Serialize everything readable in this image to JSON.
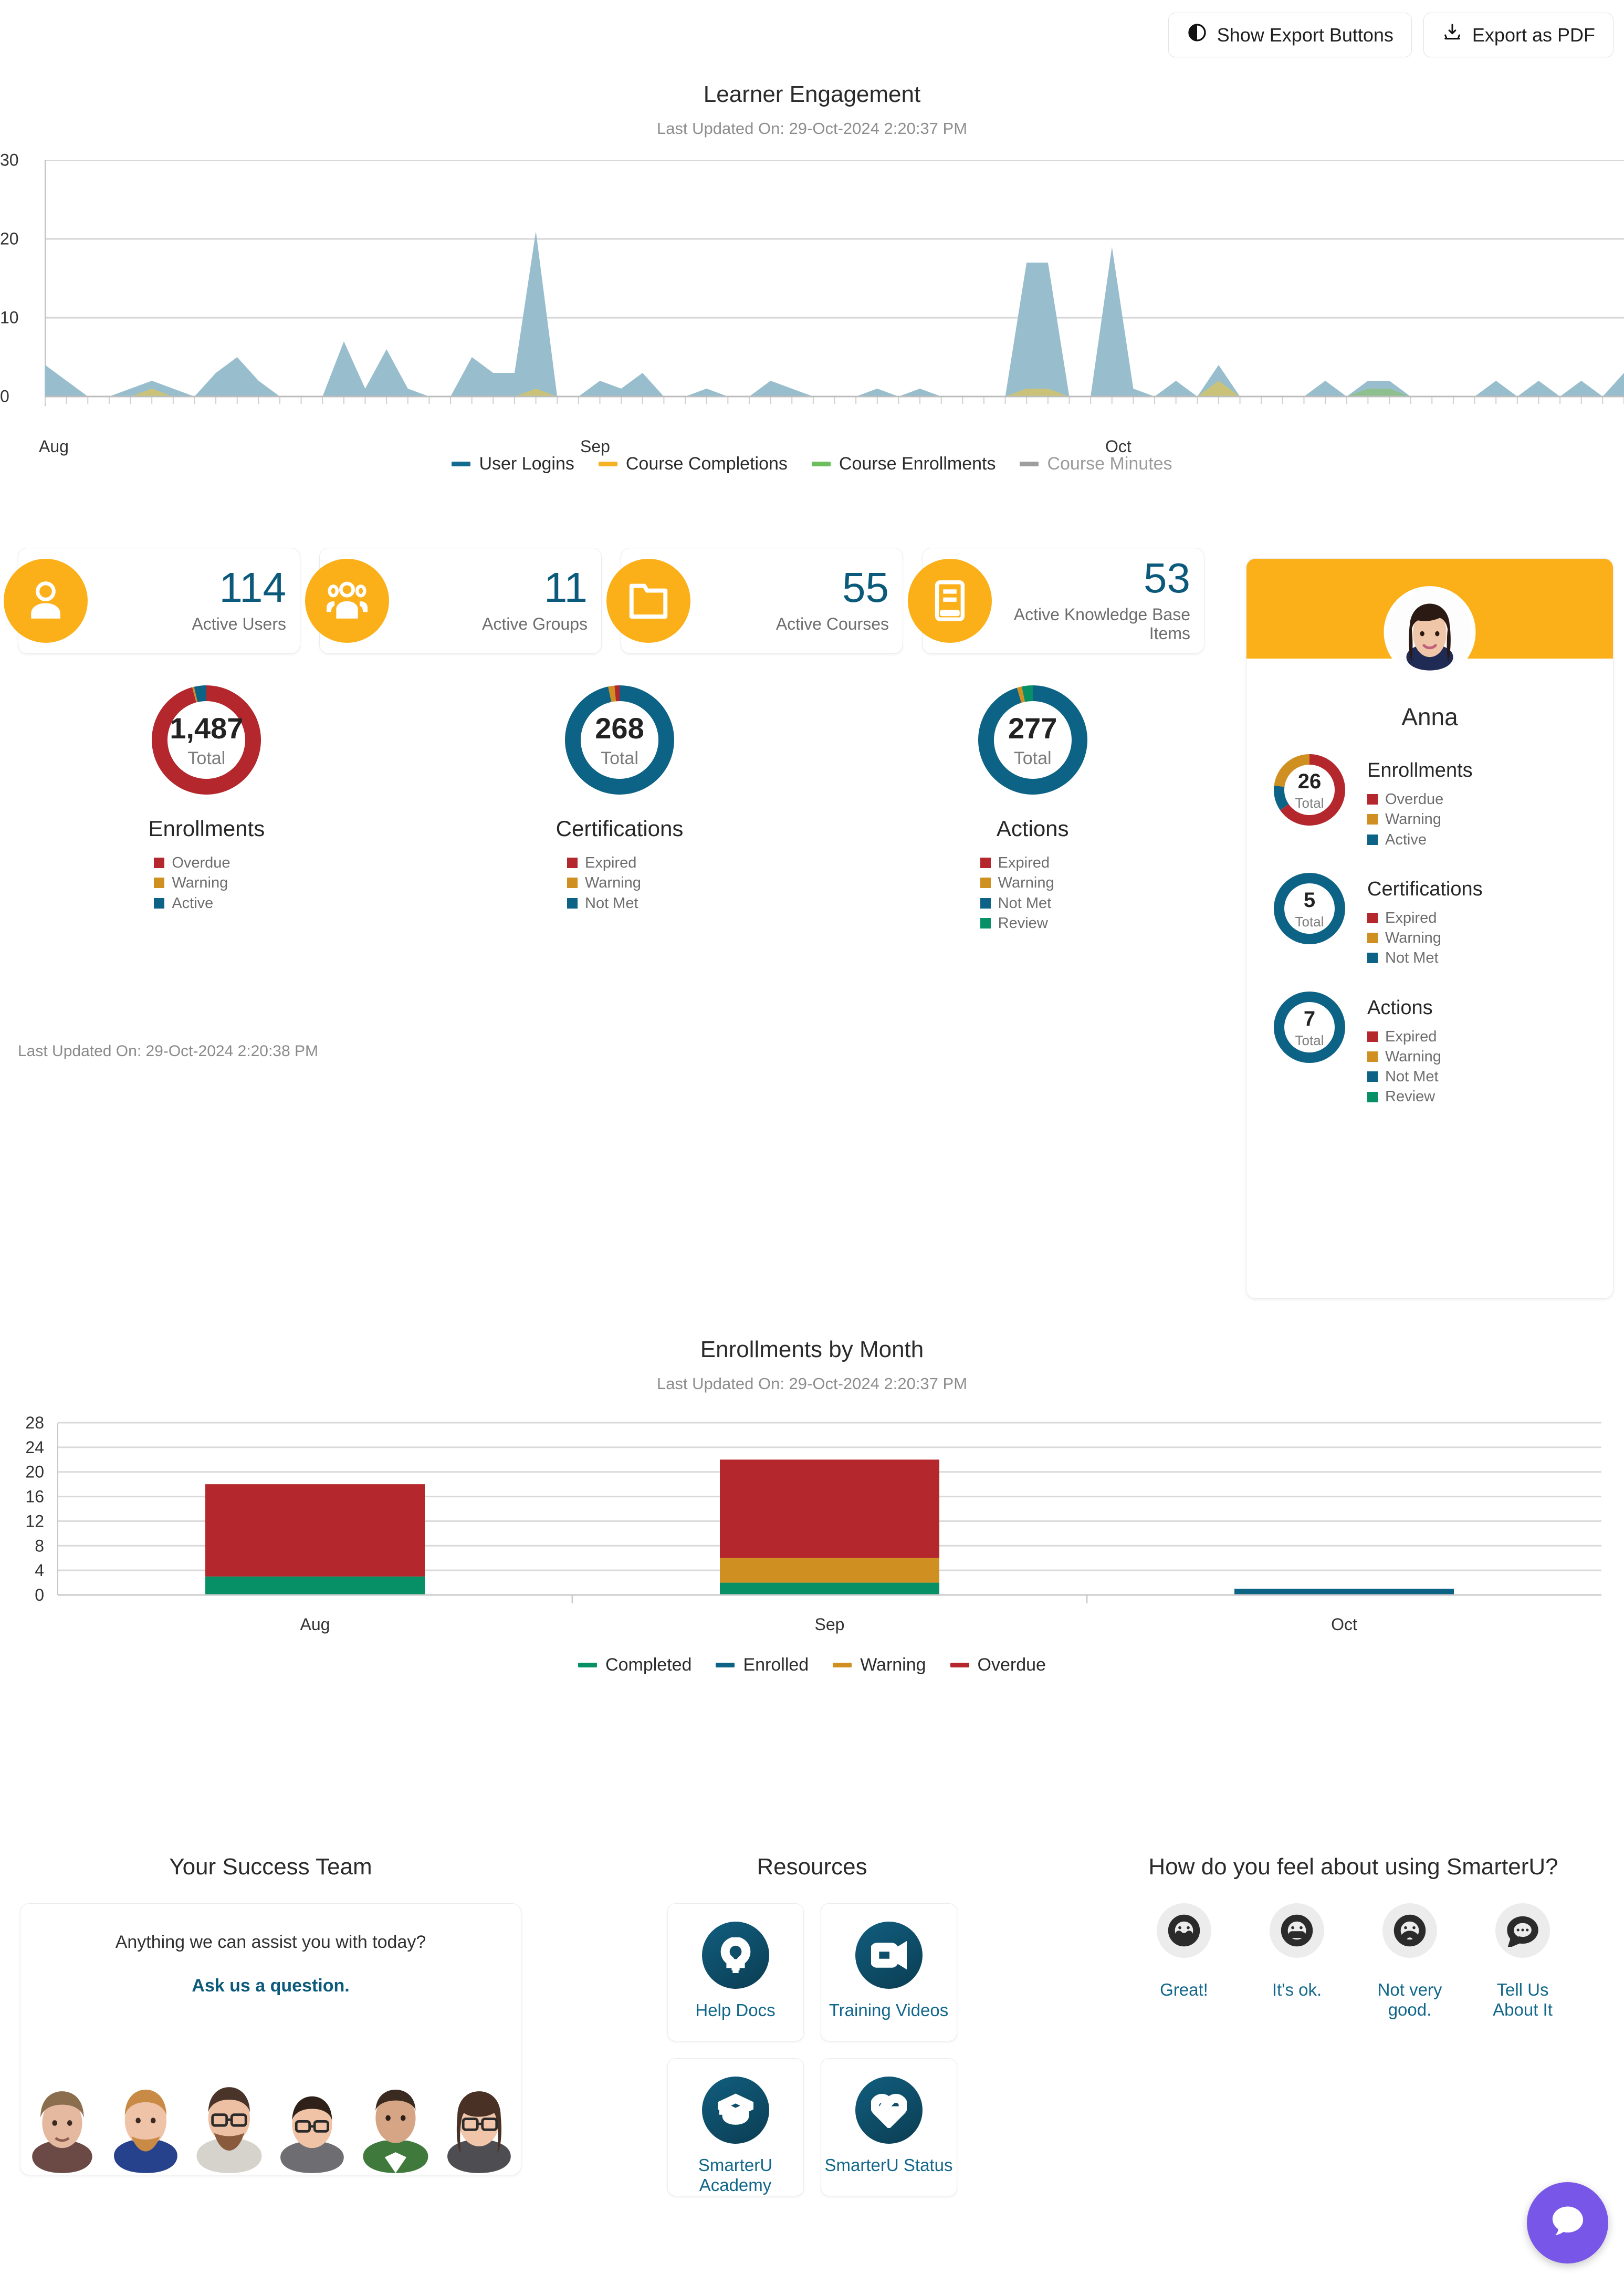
{
  "toolbar": {
    "show_export_label": "Show Export Buttons",
    "export_pdf_label": "Export as PDF"
  },
  "engagement": {
    "title": "Learner Engagement",
    "subtitle": "Last Updated On: 29-Oct-2024 2:20:37 PM",
    "y_ticks": [
      "30",
      "20",
      "10",
      "0"
    ],
    "x_ticks": [
      "Aug",
      "Sep",
      "Oct"
    ],
    "legend": [
      {
        "label": "User Logins",
        "color": "#156b8f",
        "disabled": false
      },
      {
        "label": "Course Completions",
        "color": "#f5b324",
        "disabled": false
      },
      {
        "label": "Course Enrollments",
        "color": "#6cbf5c",
        "disabled": false
      },
      {
        "label": "Course Minutes",
        "color": "#9e9e9e",
        "disabled": true
      }
    ]
  },
  "stats": [
    {
      "value": "114",
      "label": "Active Users",
      "icon": "user-icon"
    },
    {
      "value": "11",
      "label": "Active Groups",
      "icon": "users-group-icon"
    },
    {
      "value": "55",
      "label": "Active Courses",
      "icon": "folder-icon"
    },
    {
      "value": "53",
      "label": "Active Knowledge Base Items",
      "icon": "book-icon"
    }
  ],
  "donuts": [
    {
      "total": "1,487",
      "total_label": "Total",
      "heading": "Enrollments",
      "legend": [
        {
          "label": "Overdue",
          "color": "#b3272d"
        },
        {
          "label": "Warning",
          "color": "#cf9021"
        },
        {
          "label": "Active",
          "color": "#0d6385"
        }
      ],
      "segments": [
        {
          "name": "Overdue",
          "value": 1425,
          "color": "#b3272d"
        },
        {
          "name": "Warning",
          "value": 8,
          "color": "#cf9021"
        },
        {
          "name": "Active",
          "value": 54,
          "color": "#0d6385"
        }
      ]
    },
    {
      "total": "268",
      "total_label": "Total",
      "heading": "Certifications",
      "legend": [
        {
          "label": "Expired",
          "color": "#b3272d"
        },
        {
          "label": "Warning",
          "color": "#cf9021"
        },
        {
          "label": "Not Met",
          "color": "#0d6385"
        }
      ],
      "segments": [
        {
          "name": "Not Met",
          "value": 259,
          "color": "#0d6385"
        },
        {
          "name": "Warning",
          "value": 5,
          "color": "#cf9021"
        },
        {
          "name": "Expired",
          "value": 4,
          "color": "#b3272d"
        }
      ]
    },
    {
      "total": "277",
      "total_label": "Total",
      "heading": "Actions",
      "legend": [
        {
          "label": "Expired",
          "color": "#b3272d"
        },
        {
          "label": "Warning",
          "color": "#cf9021"
        },
        {
          "label": "Not Met",
          "color": "#0d6385"
        },
        {
          "label": "Review",
          "color": "#079065"
        }
      ],
      "segments": [
        {
          "name": "Not Met",
          "value": 264,
          "color": "#0d6385"
        },
        {
          "name": "Warning",
          "value": 4,
          "color": "#cf9021"
        },
        {
          "name": "Review",
          "value": 9,
          "color": "#079065"
        }
      ]
    }
  ],
  "donuts_last_updated": "Last Updated On: 29-Oct-2024 2:20:38 PM",
  "profile": {
    "name": "Anna",
    "sections": [
      {
        "total": "26",
        "total_label": "Total",
        "heading": "Enrollments",
        "legend": [
          {
            "label": "Overdue",
            "color": "#b3272d"
          },
          {
            "label": "Warning",
            "color": "#cf9021"
          },
          {
            "label": "Active",
            "color": "#0d6385"
          }
        ],
        "segments": [
          {
            "name": "Overdue",
            "value": 17,
            "color": "#b3272d"
          },
          {
            "name": "Active",
            "value": 3,
            "color": "#0d6385"
          },
          {
            "name": "Warning",
            "value": 6,
            "color": "#cf9021"
          }
        ]
      },
      {
        "total": "5",
        "total_label": "Total",
        "heading": "Certifications",
        "legend": [
          {
            "label": "Expired",
            "color": "#b3272d"
          },
          {
            "label": "Warning",
            "color": "#cf9021"
          },
          {
            "label": "Not Met",
            "color": "#0d6385"
          }
        ],
        "segments": [
          {
            "name": "Not Met",
            "value": 5,
            "color": "#0d6385"
          }
        ]
      },
      {
        "total": "7",
        "total_label": "Total",
        "heading": "Actions",
        "legend": [
          {
            "label": "Expired",
            "color": "#b3272d"
          },
          {
            "label": "Warning",
            "color": "#cf9021"
          },
          {
            "label": "Not Met",
            "color": "#0d6385"
          },
          {
            "label": "Review",
            "color": "#079065"
          }
        ],
        "segments": [
          {
            "name": "Not Met",
            "value": 7,
            "color": "#0d6385"
          }
        ]
      }
    ]
  },
  "bymonth": {
    "title": "Enrollments by Month",
    "subtitle": "Last Updated On: 29-Oct-2024 2:20:37 PM"
  },
  "success_team": {
    "title": "Your Success Team",
    "question": "Anything we can assist you with today?",
    "cta": "Ask us a question."
  },
  "resources": {
    "title": "Resources",
    "items": [
      {
        "label": "Help Docs",
        "icon": "lightbulb-icon"
      },
      {
        "label": "Training Videos",
        "icon": "video-camera-icon"
      },
      {
        "label": "SmarterU Academy",
        "icon": "graduation-cap-icon"
      },
      {
        "label": "SmarterU Status",
        "icon": "heart-pulse-icon"
      }
    ]
  },
  "feedback": {
    "title": "How do you feel about using SmarterU?",
    "options": [
      {
        "label": "Great!",
        "icon": "smiley-happy-icon"
      },
      {
        "label": "It's ok.",
        "icon": "smiley-neutral-icon"
      },
      {
        "label": "Not very good.",
        "icon": "smiley-sad-icon"
      },
      {
        "label": "Tell Us About It",
        "icon": "speech-bubble-icon"
      }
    ]
  },
  "chat": {
    "icon": "chat-bubble-icon",
    "color": "#7857e8"
  },
  "chart_data": [
    {
      "type": "area",
      "title": "Learner Engagement",
      "subtitle": "Last Updated On: 29-Oct-2024 2:20:37 PM",
      "xlabel": "",
      "ylabel": "",
      "ylim": [
        0,
        30
      ],
      "yticks": [
        0,
        10,
        20,
        30
      ],
      "grid": true,
      "legend_position": "bottom",
      "x_tick_labels": [
        "Aug",
        "Sep",
        "Oct"
      ],
      "series": [
        {
          "name": "User Logins",
          "color": "#156b8f",
          "values": [
            4,
            2,
            0,
            0,
            1,
            2,
            1,
            0,
            3,
            5,
            2,
            0,
            0,
            0,
            7,
            1,
            6,
            1,
            0,
            0,
            5,
            3,
            3,
            21,
            0,
            0,
            2,
            1,
            3,
            0,
            0,
            1,
            0,
            0,
            2,
            1,
            0,
            0,
            0,
            1,
            0,
            1,
            0,
            0,
            0,
            0,
            17,
            17,
            0,
            0,
            19,
            1,
            0,
            2,
            0,
            4,
            0,
            0,
            0,
            0,
            2,
            0,
            2,
            2,
            0,
            0,
            0,
            0,
            2,
            0,
            2,
            0,
            2,
            0,
            3
          ]
        },
        {
          "name": "Course Completions",
          "color": "#f5b324",
          "values": [
            0,
            0,
            0,
            0,
            0,
            1,
            0,
            0,
            0,
            0,
            0,
            0,
            0,
            0,
            0,
            0,
            0,
            0,
            0,
            0,
            0,
            0,
            0,
            1,
            0,
            0,
            0,
            0,
            0,
            0,
            0,
            0,
            0,
            0,
            0,
            0,
            0,
            0,
            0,
            0,
            0,
            0,
            0,
            0,
            0,
            0,
            1,
            1,
            0,
            0,
            0,
            0,
            0,
            0,
            0,
            2,
            0,
            0,
            0,
            0,
            0,
            0,
            0,
            0,
            0,
            0,
            0,
            0,
            0,
            0,
            0,
            0,
            0,
            0,
            0
          ]
        },
        {
          "name": "Course Enrollments",
          "color": "#6cbf5c",
          "values": [
            0,
            0,
            0,
            0,
            0,
            0,
            0,
            0,
            0,
            0,
            0,
            0,
            0,
            0,
            0,
            0,
            0,
            0,
            0,
            0,
            0,
            0,
            0,
            0,
            0,
            0,
            0,
            0,
            0,
            0,
            0,
            0,
            0,
            0,
            0,
            0,
            0,
            0,
            0,
            0,
            0,
            0,
            0,
            0,
            0,
            0,
            0,
            0,
            0,
            0,
            0,
            0,
            0,
            0,
            0,
            0,
            0,
            0,
            0,
            0,
            0,
            0,
            1,
            1,
            0,
            0,
            0,
            0,
            0,
            0,
            0,
            0,
            0,
            0,
            0
          ]
        },
        {
          "name": "Course Minutes",
          "color": "#9e9e9e",
          "hidden": true,
          "values": []
        }
      ]
    },
    {
      "type": "bar",
      "stacked": true,
      "title": "Enrollments by Month",
      "subtitle": "Last Updated On: 29-Oct-2024 2:20:37 PM",
      "categories": [
        "Aug",
        "Sep",
        "Oct"
      ],
      "xlabel": "",
      "ylabel": "",
      "ylim": [
        0,
        28
      ],
      "yticks": [
        0,
        4,
        8,
        12,
        16,
        20,
        24,
        28
      ],
      "grid": true,
      "legend_position": "bottom",
      "series": [
        {
          "name": "Completed",
          "color": "#079065",
          "values": [
            3,
            2,
            0
          ]
        },
        {
          "name": "Enrolled",
          "color": "#0d6385",
          "values": [
            0,
            0,
            1
          ]
        },
        {
          "name": "Warning",
          "color": "#cf9021",
          "values": [
            0,
            4,
            0
          ]
        },
        {
          "name": "Overdue",
          "color": "#b3272d",
          "values": [
            15,
            16,
            0
          ]
        }
      ]
    }
  ]
}
